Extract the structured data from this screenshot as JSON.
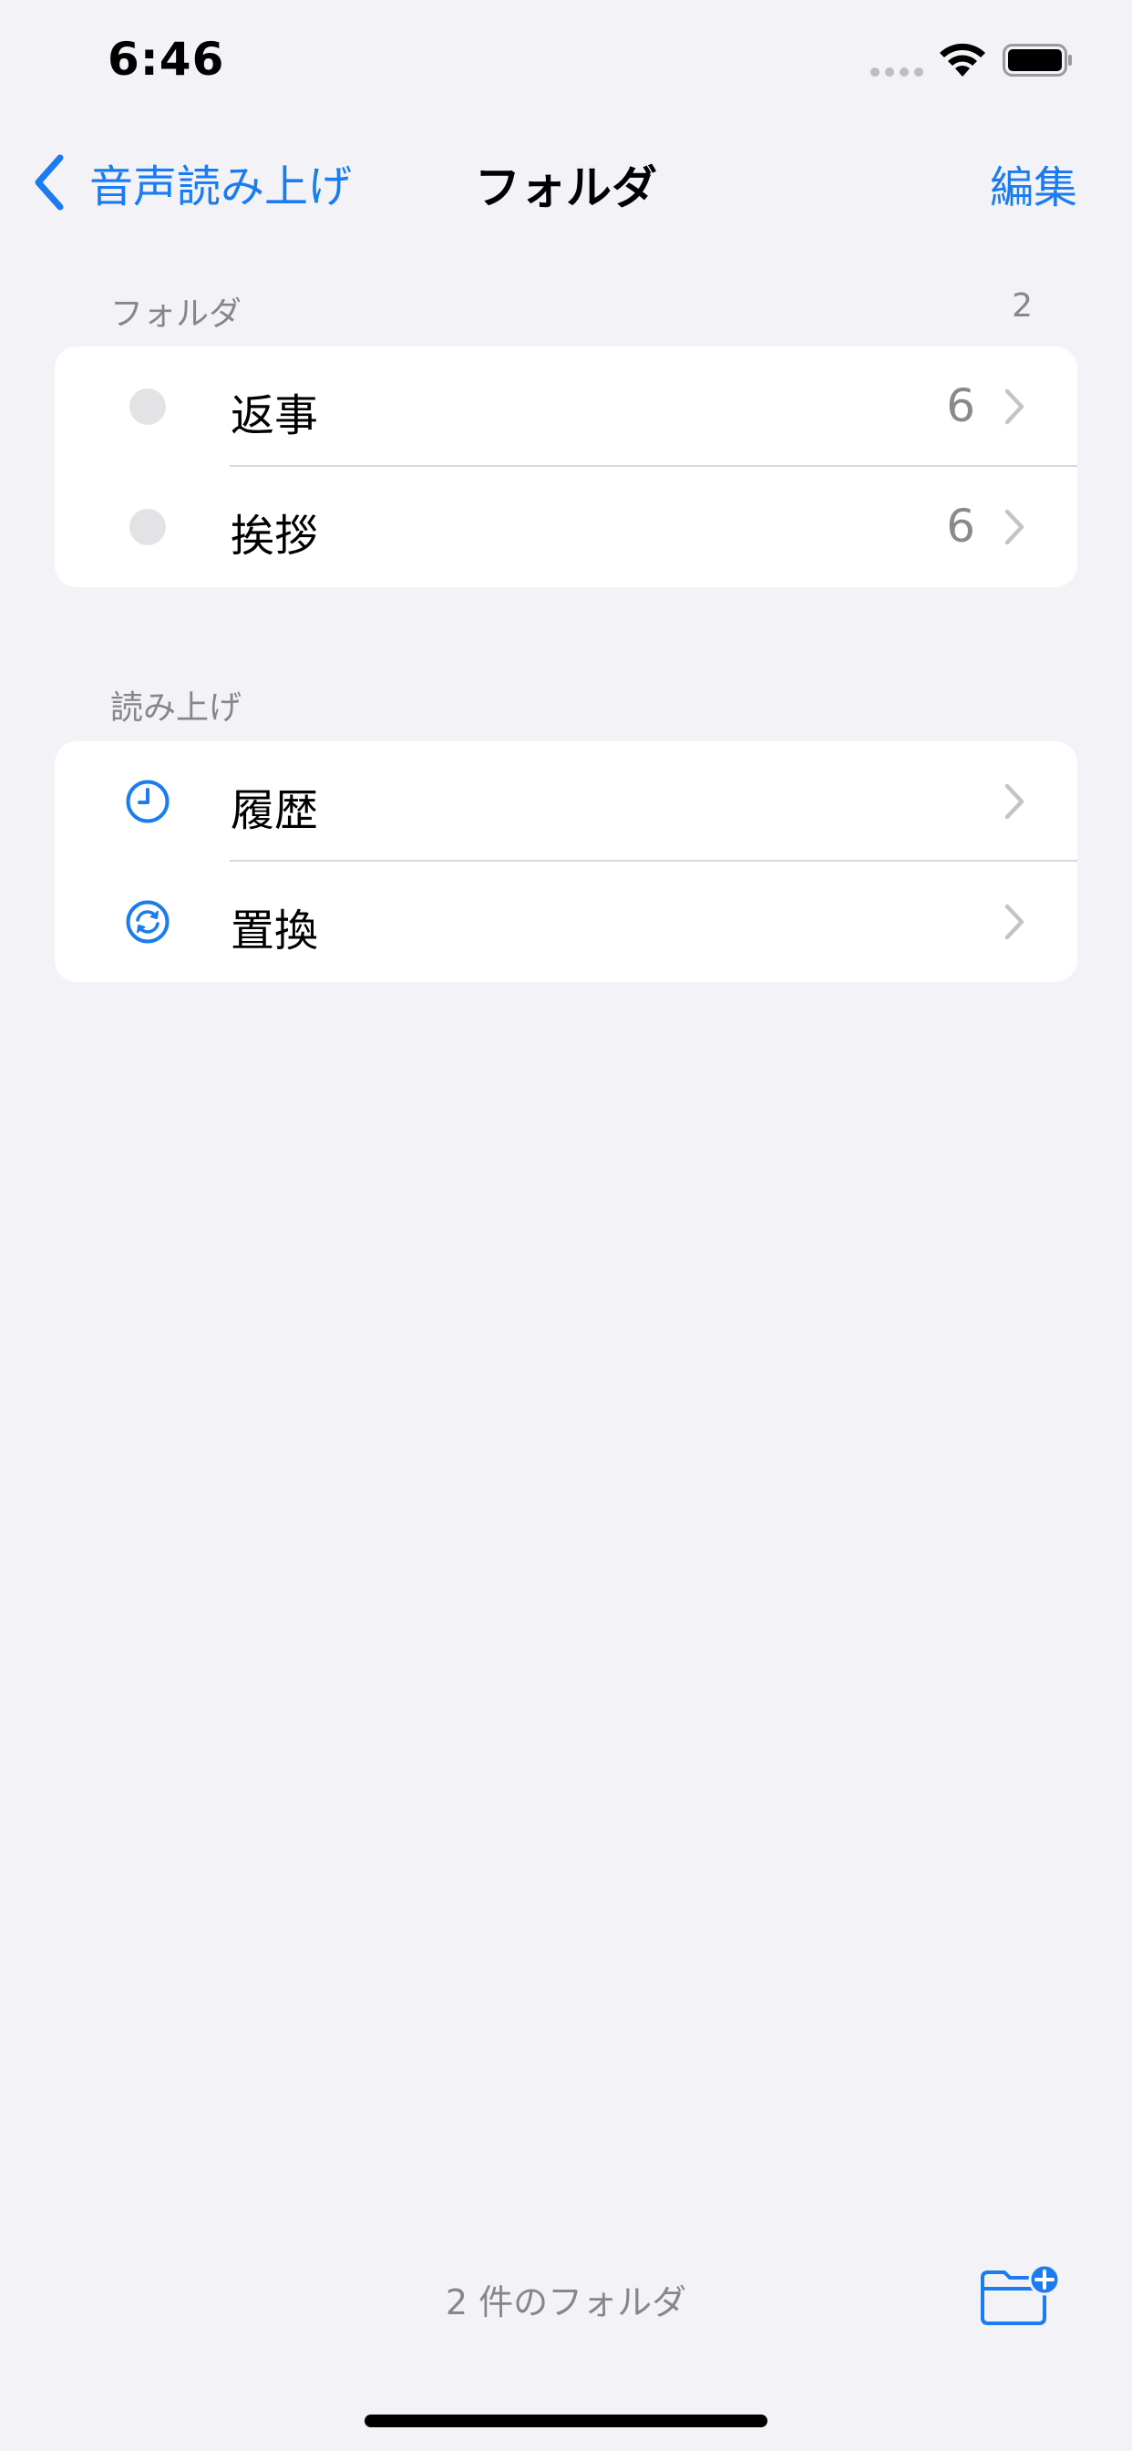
{
  "status_bar": {
    "time": "6:46"
  },
  "nav": {
    "back_label": "音声読み上げ",
    "title": "フォルダ",
    "edit_label": "編集"
  },
  "sections": {
    "folders": {
      "header": "フォルダ",
      "count": "2",
      "items": [
        {
          "label": "返事",
          "count": "6"
        },
        {
          "label": "挨拶",
          "count": "6"
        }
      ]
    },
    "readout": {
      "header": "読み上げ",
      "items": [
        {
          "label": "履歴",
          "icon": "clock-icon"
        },
        {
          "label": "置換",
          "icon": "arrows-cycle-icon"
        }
      ]
    }
  },
  "footer": {
    "summary": "2 件のフォルダ",
    "new_folder_icon": "folder-plus-icon"
  },
  "colors": {
    "accent": "#1a7cf0",
    "background": "#f2f2f7",
    "secondary_text": "#86868b"
  }
}
